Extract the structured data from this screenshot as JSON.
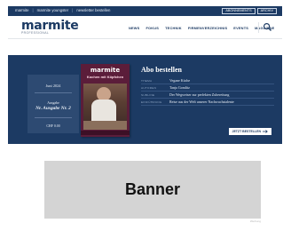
{
  "topbar": {
    "links": [
      "marmite",
      "marmite youngster",
      "newsletter bestellen"
    ],
    "buttons": [
      "ABONNEMENTS",
      "ARCHIV"
    ]
  },
  "header": {
    "logo": "marmite",
    "logo_sub": "PROFESSIONAL",
    "nav": [
      "NEWS",
      "FOKUS",
      "TECHNIK",
      "FIRMENVERZEICHNIS",
      "EVENTS",
      "MAGAZINE"
    ],
    "search_icon": "search-icon"
  },
  "hero": {
    "issue": {
      "date": "Juni 2024",
      "label": "Ausgabe",
      "number": "Nr. Ausgabe Nr. 2",
      "price": "CHF 0.00"
    },
    "magazine": {
      "logo": "marmite",
      "headline": "Kochen mit Köpfchen"
    },
    "abo": {
      "title": "Abo bestellen",
      "rows": [
        {
          "key": "THEMA",
          "value": "Vegane Küche"
        },
        {
          "key": "AUTOREN",
          "value": "Tanja Gomlitz"
        },
        {
          "key": "SUBLINE",
          "value": "Der Wegweiser zur perfekten Zubereitung"
        },
        {
          "key": "EINFÜHRUNG",
          "value": "Reise aus der Welt unserer Nachwuchstalente"
        }
      ],
      "cta": "JETZT BESTELLEN"
    }
  },
  "banner": {
    "label": "Banner",
    "note": "Werbung"
  },
  "colors": {
    "brand": "#1c3a63",
    "magazine": "#5b1d3a",
    "banner_bg": "#d4d4d4"
  }
}
